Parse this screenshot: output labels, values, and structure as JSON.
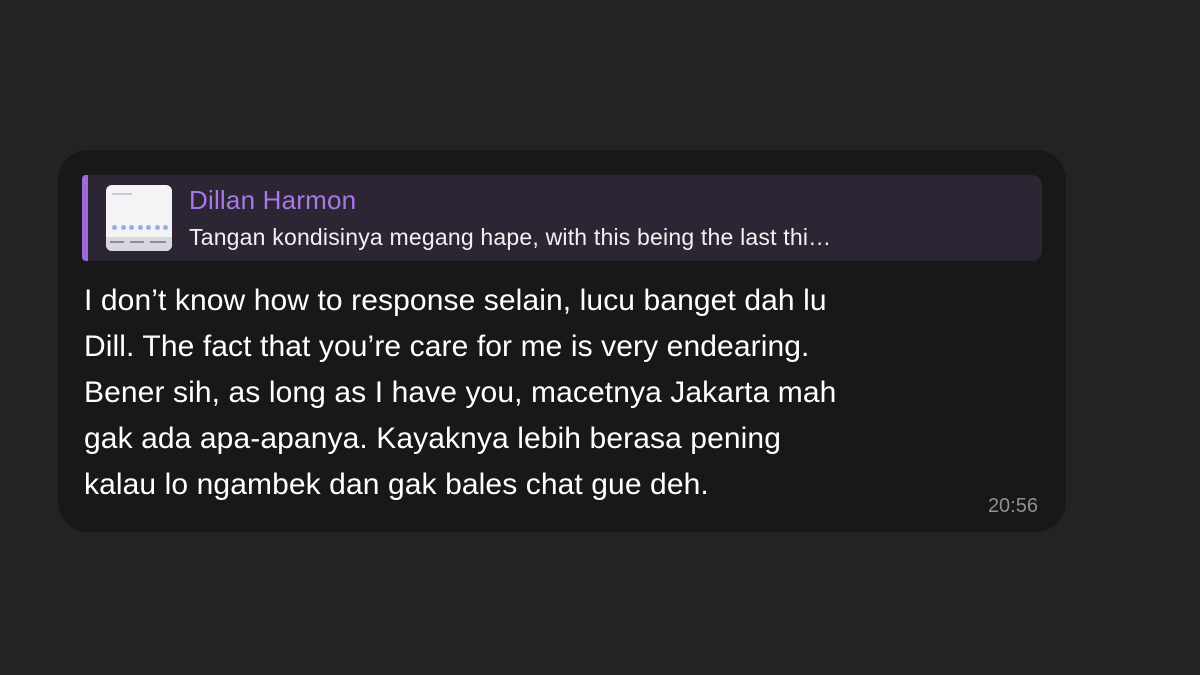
{
  "message": {
    "reply": {
      "sender": "Dillan Harmon",
      "preview": "Tangan kondisinya megang hape, with this being the last thi…",
      "thumbnail_icon": "keyboard-screenshot-thumbnail"
    },
    "lines": [
      "I don’t know how to response selain, lucu banget dah lu",
      "Dill. The fact that you’re care for me is very endearing.",
      "Bener sih, as long as I have you, macetnya Jakarta mah",
      "gak ada apa-apanya. Kayaknya lebih berasa pening",
      "kalau lo ngambek dan gak bales chat gue deh."
    ],
    "time": "20:56"
  },
  "colors": {
    "background": "#232323",
    "bubble": "#181818",
    "reply_background": "#2c2533",
    "accent": "#9e6ad8",
    "sender_name": "#a977e6",
    "timestamp": "#8e8e93"
  }
}
